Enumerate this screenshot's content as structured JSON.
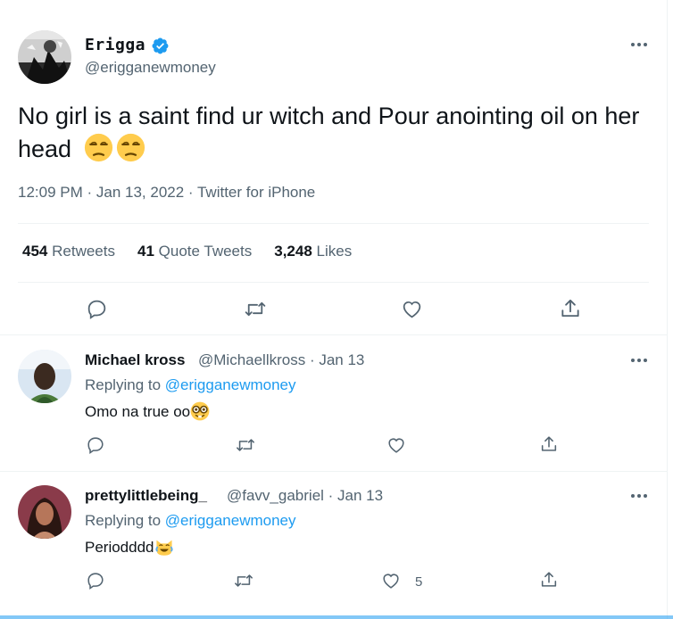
{
  "tweet": {
    "author_name": "Erigga",
    "author_handle": "@erigganewmoney",
    "text": "No girl is a saint find ur witch and Pour anointing oil on her head",
    "emoji": "unamused-face-emoji x2",
    "meta": "12:09 PM · Jan 13, 2022 · Twitter for iPhone",
    "stats": {
      "retweets_count": "454",
      "retweets_label": "Retweets",
      "quotes_count": "41",
      "quotes_label": "Quote Tweets",
      "likes_count": "3,248",
      "likes_label": "Likes"
    },
    "actions": [
      "reply-icon",
      "retweet-icon",
      "like-icon",
      "share-icon"
    ]
  },
  "replies": [
    {
      "name": "Michael kross",
      "handle_date": "@Michaellkross · Jan 13",
      "replying_prefix": "Replying to ",
      "replying_to": "@erigganewmoney",
      "text": "Omo na true oo",
      "emoji": "nerd-face-emoji",
      "like_count": ""
    },
    {
      "name": "prettylittlebeing_",
      "handle_date": "@favv_gabriel · Jan 13",
      "replying_prefix": "Replying to ",
      "replying_to": "@erigganewmoney",
      "text": "Periodddd",
      "emoji": "crying-laughing-cat-emoji",
      "like_count": "5"
    }
  ],
  "colors": {
    "text": "#0f1419",
    "secondary": "#536471",
    "accent": "#1d9bf0",
    "divider": "#eff3f4"
  }
}
